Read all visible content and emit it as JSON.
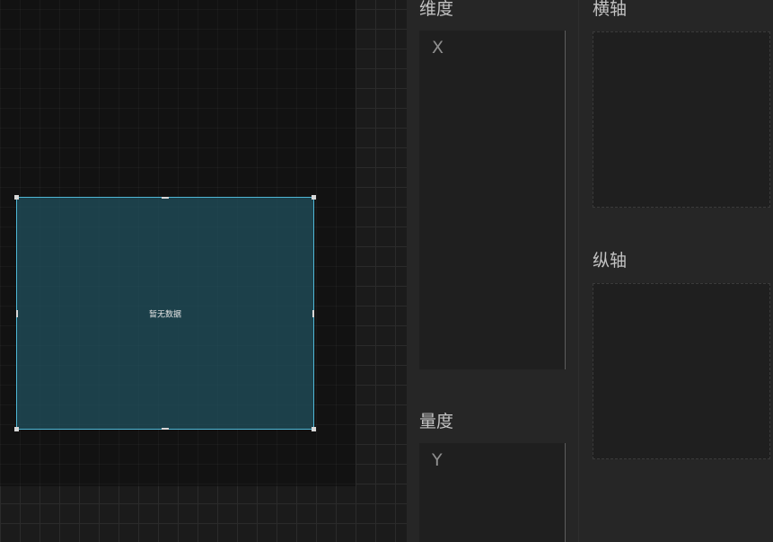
{
  "canvas": {
    "widget": {
      "empty_text": "暂无数据"
    }
  },
  "panel": {
    "dimension": {
      "title": "维度",
      "items": [
        "X"
      ]
    },
    "measure": {
      "title": "量度",
      "items": [
        "Y"
      ]
    },
    "x_axis": {
      "title": "横轴"
    },
    "y_axis": {
      "title": "纵轴"
    }
  },
  "colors": {
    "widget_border": "#4fb7d6",
    "widget_fill": "#205260"
  }
}
